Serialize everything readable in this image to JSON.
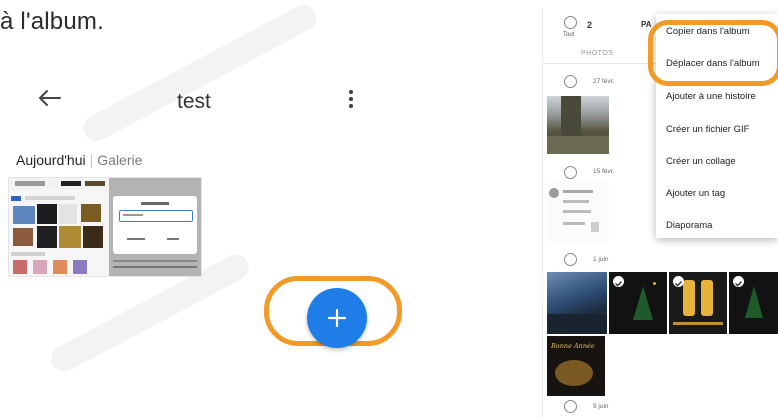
{
  "article": {
    "intro_text": "à l'album."
  },
  "album_screen": {
    "back_icon": "arrow-left-icon",
    "title": "test",
    "menu_icon": "more-vertical-icon",
    "breadcrumb_current": "Aujourd'hui",
    "breadcrumb_separator": "|",
    "breadcrumb_source": "Galerie",
    "add_icon": "plus-icon",
    "colors": {
      "fab": "#1f7de8",
      "highlight": "#f29a28"
    }
  },
  "gallery_screen": {
    "selected_count": "2",
    "select_all_label": "Tout",
    "title_partial": "PA",
    "tab_label": "PHOTOS",
    "dates": [
      "27 févr.",
      "15 févr.",
      "1 juin",
      "9 juin"
    ],
    "photo_caption": "Bonne Année"
  },
  "context_menu": {
    "items": [
      "Copier dans l'album",
      "Déplacer dans l'album",
      "Ajouter à une histoire",
      "Créer un fichier GIF",
      "Créer un collage",
      "Ajouter un tag",
      "Diaporama"
    ]
  }
}
